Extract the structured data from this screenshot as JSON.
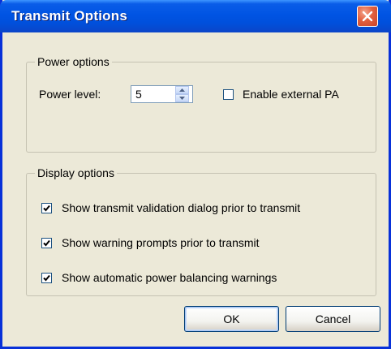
{
  "window": {
    "title": "Transmit Options"
  },
  "power_options": {
    "legend": "Power options",
    "power_level_label": "Power level:",
    "power_level_value": "5",
    "enable_external_pa": {
      "label": "Enable external PA",
      "checked": false
    }
  },
  "display_options": {
    "legend": "Display options",
    "items": [
      {
        "label": "Show transmit validation dialog prior to transmit",
        "checked": true
      },
      {
        "label": "Show warning prompts prior to transmit",
        "checked": true
      },
      {
        "label": "Show automatic power balancing warnings",
        "checked": true
      }
    ]
  },
  "buttons": {
    "ok": "OK",
    "cancel": "Cancel"
  },
  "colors": {
    "titlebar": "#0054e3",
    "dialog_background": "#ece9d8",
    "close_button": "#e3603f"
  },
  "icons": {
    "close": "close-icon",
    "spin_up": "spin-up-icon",
    "spin_down": "spin-down-icon",
    "check": "checkmark-icon"
  }
}
